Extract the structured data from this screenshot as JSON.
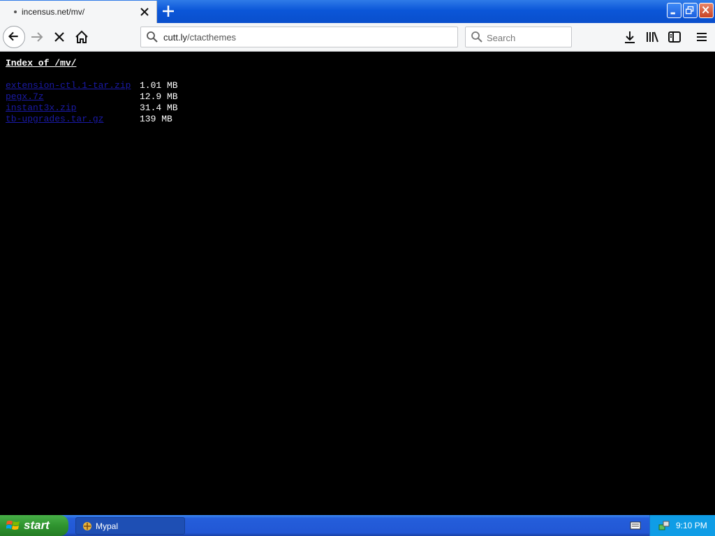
{
  "browser": {
    "tab": {
      "title": "incensus.net/mv/"
    },
    "url": {
      "domain": "cutt.ly",
      "path": "/ctacthemes"
    },
    "search": {
      "placeholder": "Search"
    }
  },
  "page": {
    "heading": "Index of /mv/",
    "files": [
      {
        "name": "extension-ctl.1-tar.zip",
        "size": "1.01 MB"
      },
      {
        "name": "pegx.7z",
        "size": "12.9 MB"
      },
      {
        "name": "instant3x.zip",
        "size": "31.4 MB"
      },
      {
        "name": "tb-upgrades.tar.gz",
        "size": "139 MB"
      }
    ]
  },
  "taskbar": {
    "start_label": "start",
    "window_label": "Mypal",
    "clock": "9:10 PM"
  },
  "colors": {
    "link": "#1a1aa6",
    "background": "#000000",
    "text": "#ffffff"
  }
}
